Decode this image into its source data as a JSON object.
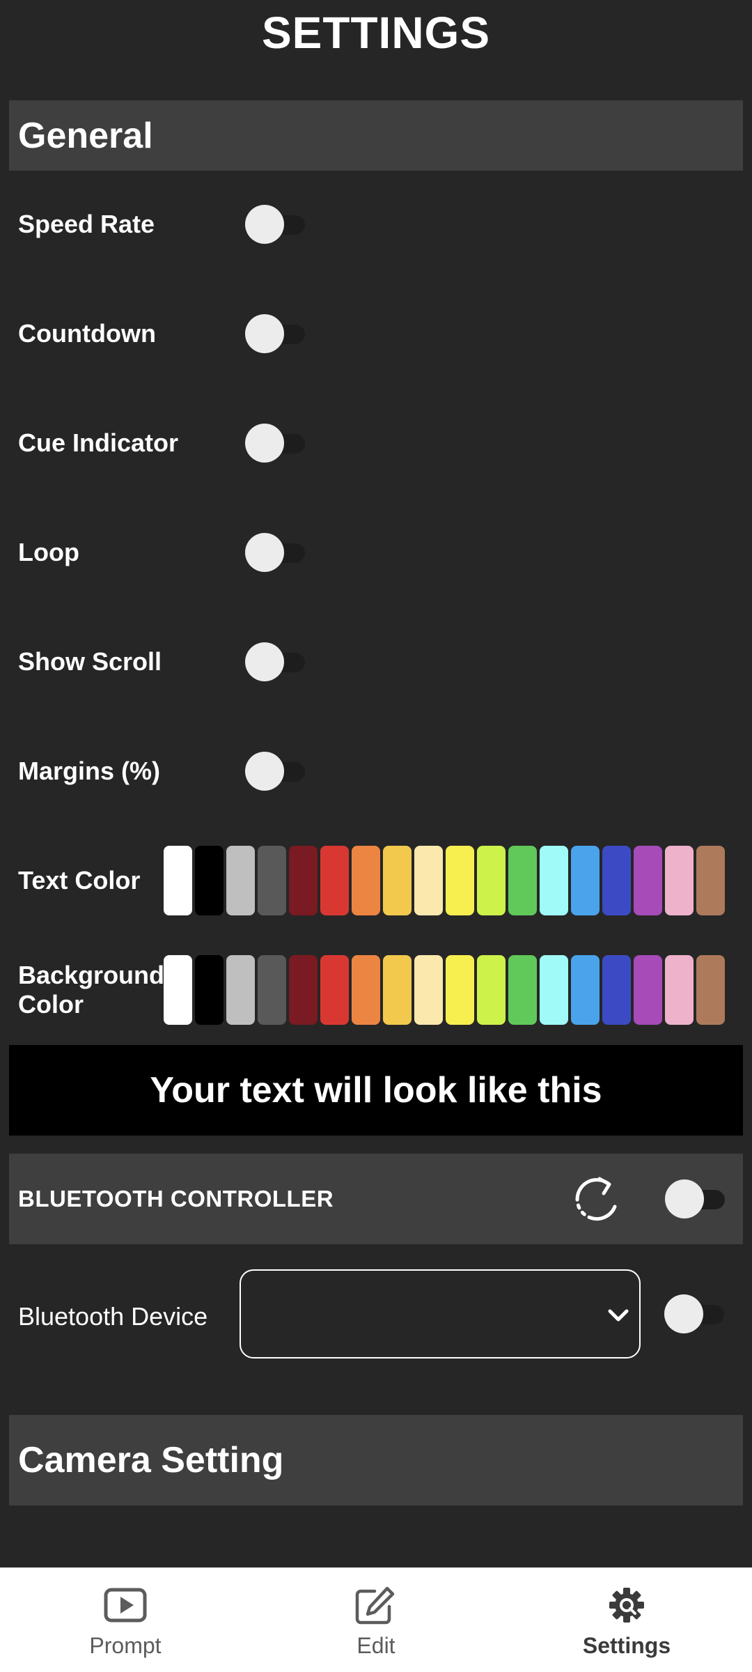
{
  "header": {
    "title": "SETTINGS"
  },
  "general": {
    "title": "General",
    "toggles": [
      {
        "label": "Speed Rate",
        "on": false
      },
      {
        "label": "Countdown",
        "on": false
      },
      {
        "label": "Cue Indicator",
        "on": false
      },
      {
        "label": "Loop",
        "on": false
      },
      {
        "label": "Show Scroll",
        "on": false
      },
      {
        "label": "Margins (%)",
        "on": false
      }
    ],
    "text_color_label": "Text Color",
    "background_color_label": "Background Color",
    "palette": [
      "#ffffff",
      "#000000",
      "#bfbfbf",
      "#595959",
      "#7a1a22",
      "#d93832",
      "#ec8542",
      "#f2c94c",
      "#fae8ad",
      "#f7ef4f",
      "#cdf24a",
      "#60c95a",
      "#a0fbf8",
      "#4aa3eb",
      "#3c4bc4",
      "#a64bb8",
      "#efb2cb",
      "#ae7a5c"
    ]
  },
  "preview": {
    "text": "Your text will look like this",
    "text_color": "#ffffff",
    "background_color": "#000000"
  },
  "bluetooth": {
    "title": "BLUETOOTH CONTROLLER",
    "header_toggle_on": false,
    "device_label": "Bluetooth Device",
    "device_value": "",
    "device_toggle_on": false
  },
  "camera": {
    "title": "Camera Setting"
  },
  "bottom_nav": {
    "items": [
      {
        "label": "Prompt",
        "icon": "play-icon",
        "active": false
      },
      {
        "label": "Edit",
        "icon": "edit-icon",
        "active": false
      },
      {
        "label": "Settings",
        "icon": "settings-icon",
        "active": true
      }
    ]
  }
}
